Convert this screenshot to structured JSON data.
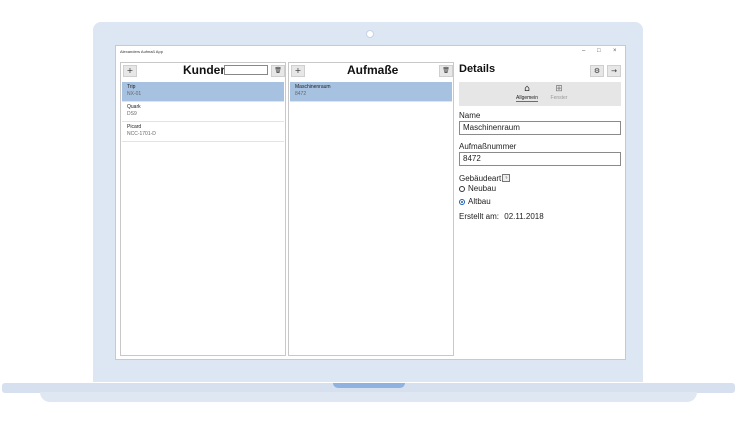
{
  "window": {
    "title": "Alexanders Aufmaß App",
    "controls": {
      "minimize": "–",
      "maximize": "□",
      "close": "×"
    }
  },
  "customers": {
    "add_icon": "+",
    "title": "Kunden",
    "search_value": "",
    "delete_icon": "🗑",
    "items": [
      {
        "name": "Trip",
        "code": "NX-01",
        "selected": true
      },
      {
        "name": "Quark",
        "code": "DS9",
        "selected": false
      },
      {
        "name": "Picard",
        "code": "NCC-1701-D",
        "selected": false
      }
    ]
  },
  "measurements": {
    "add_icon": "+",
    "title": "Aufmaße",
    "delete_icon": "🗑",
    "items": [
      {
        "name": "Maschinenraum",
        "number": "8472",
        "selected": true
      }
    ]
  },
  "details": {
    "title": "Details",
    "settings_icon": "⚙",
    "forward_icon": "→",
    "tabs": [
      {
        "label": "Allgemein",
        "icon": "house-icon",
        "active": true
      },
      {
        "label": "Fenster",
        "icon": "window-icon",
        "active": false
      }
    ],
    "name_label": "Name",
    "name_value": "Maschinenraum",
    "number_label": "Aufmaßnummer",
    "number_value": "8472",
    "building_type_label": "Gebäudeart",
    "building_type_options": [
      "Neubau",
      "Altbau"
    ],
    "building_type_selected": "Altbau",
    "created_label": "Erstellt am:",
    "created_value": "02.11.2018"
  },
  "colors": {
    "selection": "#a6c2e0",
    "accent": "#1e5fb4",
    "laptop_frame": "#dde6f3",
    "laptop_notch": "#8fb2e0"
  }
}
